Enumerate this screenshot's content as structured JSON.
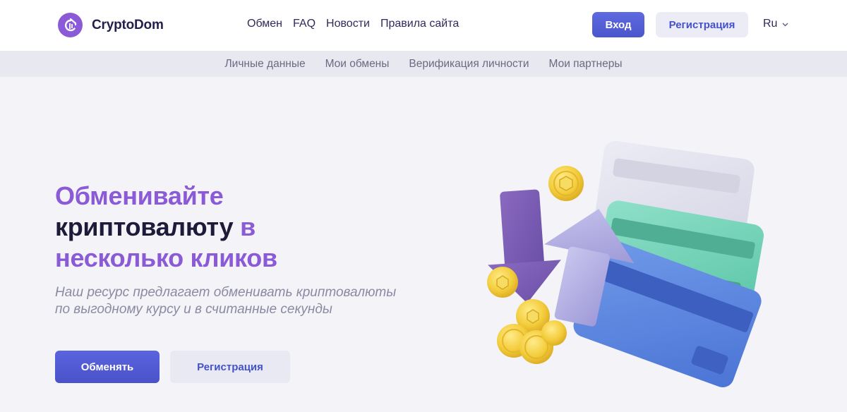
{
  "header": {
    "logo_text": "CryptoDom",
    "nav": [
      "Обмен",
      "FAQ",
      "Новости",
      "Правила сайта"
    ],
    "login_label": "Вход",
    "register_label": "Регистрация",
    "language": "Ru"
  },
  "subnav": [
    "Личные данные",
    "Мои обмены",
    "Верификация личности",
    "Мои партнеры"
  ],
  "hero": {
    "title_line1": "Обменивайте",
    "title_line2_dark": "криптовалюту",
    "title_line2_purple": "в",
    "title_line3": "несколько кликов",
    "description_line1": "Наш ресурс предлагает обменивать криптовалюты",
    "description_line2": "по выгодному курсу и в считанные секунды",
    "exchange_button": "Обменять",
    "register_button": "Регистрация"
  },
  "colors": {
    "accent_purple": "#8b5ad6",
    "primary_blue": "#4f5bd5",
    "dark_text": "#1e1b3a",
    "background": "#f3f3f8"
  },
  "icons": [
    "crypto-logo-icon",
    "chevron-down-icon",
    "hero-illustration"
  ]
}
